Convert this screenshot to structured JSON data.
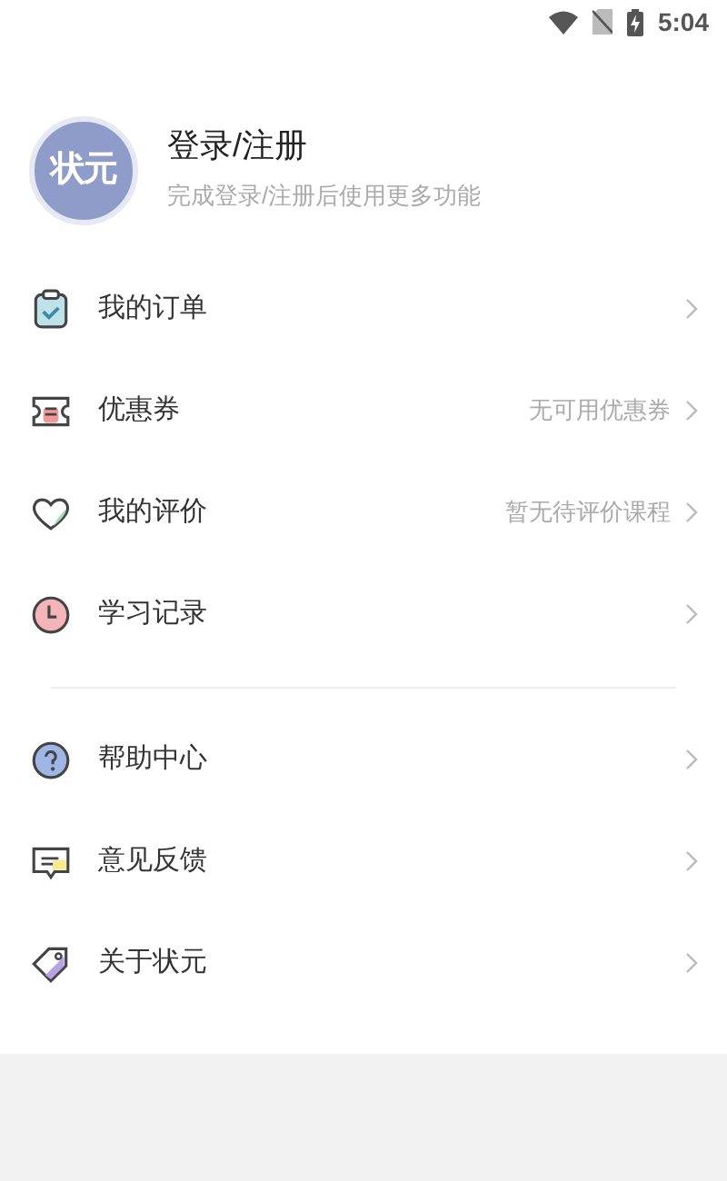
{
  "status_bar": {
    "time": "5:04"
  },
  "profile": {
    "avatar_text": "状元",
    "title": "登录/注册",
    "subtitle": "完成登录/注册后使用更多功能"
  },
  "menu_groups": [
    {
      "items": [
        {
          "label": "我的订单"
        },
        {
          "label": "优惠券",
          "value": "无可用优惠券"
        },
        {
          "label": "我的评价",
          "value": "暂无待评价课程"
        },
        {
          "label": "学习记录"
        }
      ]
    },
    {
      "items": [
        {
          "label": "帮助中心"
        },
        {
          "label": "意见反馈"
        },
        {
          "label": "关于状元"
        }
      ]
    }
  ]
}
